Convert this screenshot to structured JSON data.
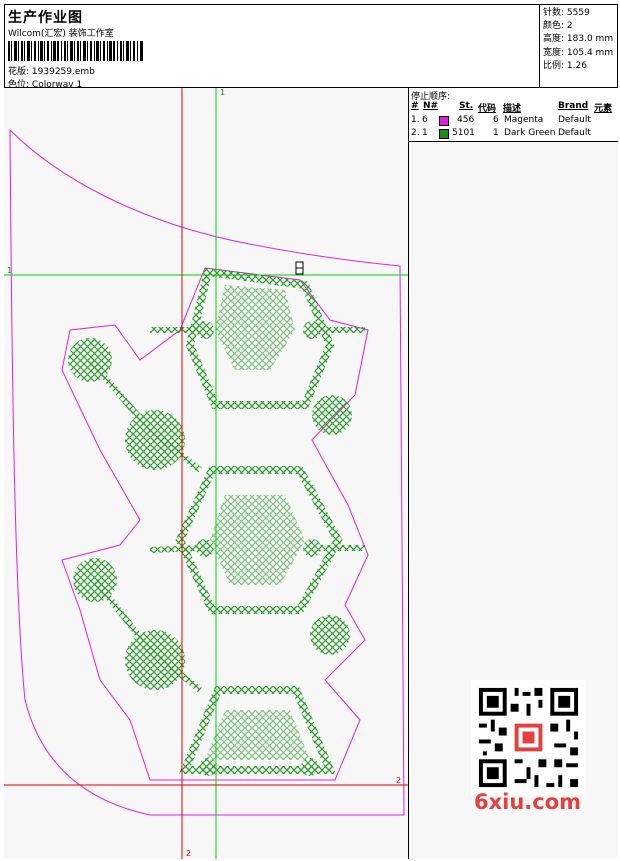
{
  "header": {
    "title": "生产作业图",
    "subtitle": "Wilcom(汇宏) 装饰工作室",
    "pattern_label": "花版:",
    "pattern_value": "1939259.emb",
    "colorway_label": "色位:",
    "colorway_value": "Colorway 1"
  },
  "stats": {
    "stitches_label": "针数:",
    "stitches_value": "5559",
    "colors_label": "颜色:",
    "colors_value": "2",
    "height_label": "高度:",
    "height_value": "183.0 mm",
    "width_label": "宽度:",
    "width_value": "105.4 mm",
    "scale_label": "比例:",
    "scale_value": "1.26"
  },
  "stop_sequence": {
    "title": "停止顺序:",
    "headers": [
      "#",
      "N#",
      "St.",
      "代码",
      "描述",
      "Brand",
      "元素"
    ],
    "rows": [
      {
        "order": "1.",
        "n": "6",
        "color": "#e020e0",
        "stitches": "456",
        "code": "6",
        "description": "Magenta",
        "brand": "Default"
      },
      {
        "order": "2.",
        "n": "1",
        "color": "#1a8a1a",
        "stitches": "5101",
        "code": "1",
        "description": "Dark Green",
        "brand": "Default"
      }
    ]
  },
  "markers": {
    "h1": "1",
    "v1": "1",
    "h2": "2",
    "v2": "2"
  },
  "watermark": "6xiu.com",
  "colors": {
    "outline": "#e020e0",
    "stitch": "#2a9a2a",
    "guide_green": "#00d000",
    "guide_red": "#e00000"
  }
}
